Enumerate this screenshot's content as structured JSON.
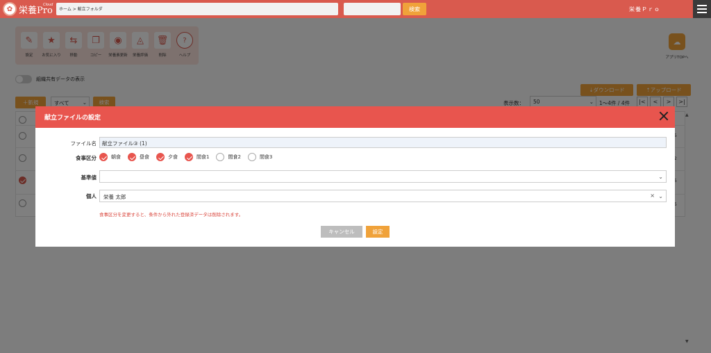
{
  "header": {
    "logo_text": "栄養Pro",
    "logo_sub": "Cloud",
    "breadcrumb": "ホーム > 献立フォルダ",
    "search_value": "",
    "search_label": "検索",
    "app_name": "栄養Ｐｒｏ"
  },
  "toolbar": {
    "items": [
      {
        "label": "設定",
        "icon": "edit-icon",
        "glyph": "✎"
      },
      {
        "label": "お気に入り",
        "icon": "star-icon",
        "glyph": "★"
      },
      {
        "label": "移動",
        "icon": "move-folder-icon",
        "glyph": "⇆"
      },
      {
        "label": "コピー",
        "icon": "copy-icon",
        "glyph": "❐"
      },
      {
        "label": "栄養素更新",
        "icon": "nutrient-update-icon",
        "glyph": "◉"
      },
      {
        "label": "栄養評価",
        "icon": "nutrition-eval-icon",
        "glyph": "◬"
      },
      {
        "label": "削除",
        "icon": "trash-icon",
        "glyph": "🗑"
      },
      {
        "label": "ヘルプ",
        "icon": "help-icon",
        "glyph": "?"
      }
    ],
    "app_top_label": "アプリTOPへ"
  },
  "list": {
    "shared_toggle_label": "組織共有データの表示",
    "download_label": "⇣ダウンロード",
    "upload_label": "⇡アップロード",
    "new_label": "＋新規",
    "filter_value": "すべて",
    "filter_search_label": "検索",
    "page_size_label": "表示数：",
    "page_size_value": "50",
    "count_text": "1〜4件 / 4件",
    "pager": [
      "|<",
      "<",
      ">",
      ">|"
    ],
    "right_values": [
      "5",
      "2",
      "5",
      "5"
    ]
  },
  "modal": {
    "title": "献立ファイルの設定",
    "file_name_label": "ファイル名",
    "file_name_value": "献立ファイル③ (1)",
    "meal_label": "食事区分",
    "meals": [
      {
        "label": "朝食",
        "checked": true
      },
      {
        "label": "昼食",
        "checked": true
      },
      {
        "label": "夕食",
        "checked": true
      },
      {
        "label": "間食1",
        "checked": true
      },
      {
        "label": "間食2",
        "checked": false
      },
      {
        "label": "間食3",
        "checked": false
      }
    ],
    "standard_label": "基準値",
    "standard_value": "",
    "person_label": "個人",
    "person_value": "栄養 太郎",
    "warning": "食事区分を変更すると、条件から外れた登録済データは削除されます。",
    "cancel_label": "キャンセル",
    "ok_label": "設定"
  },
  "colors": {
    "brand": "#d95a4e",
    "modal_header": "#e8554e",
    "accent": "#f0a23a"
  }
}
